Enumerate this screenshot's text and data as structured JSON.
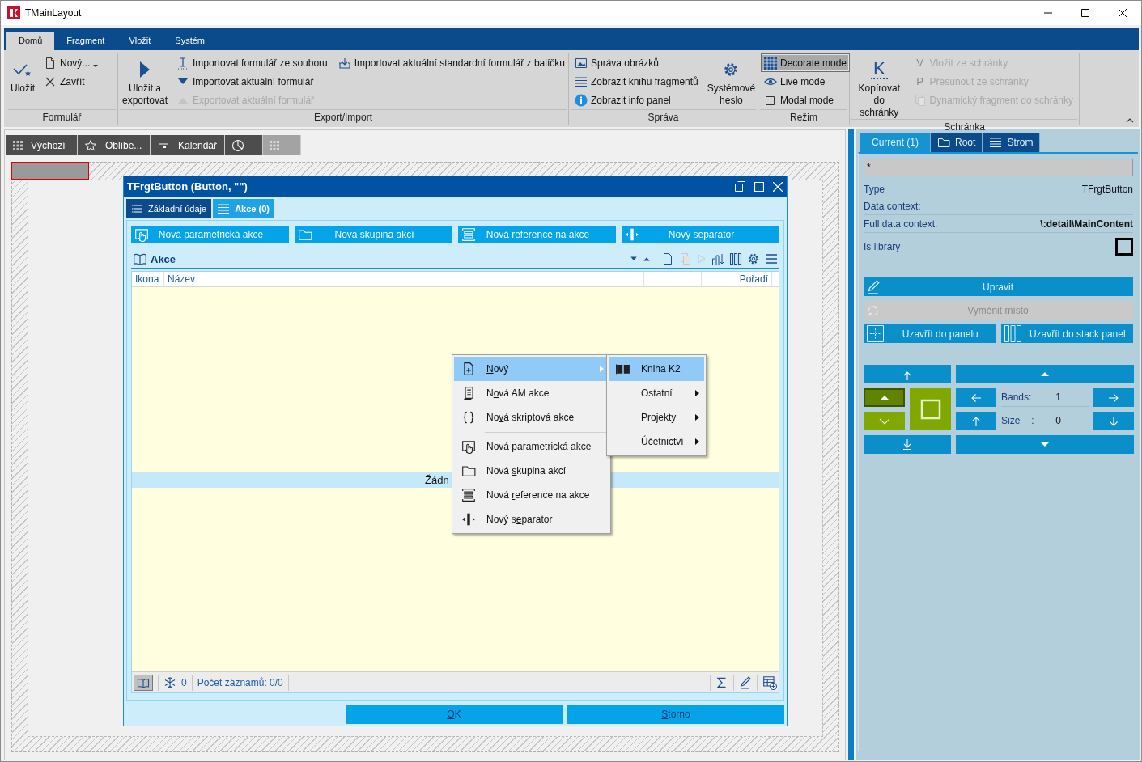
{
  "window": {
    "title": "TMainLayout"
  },
  "ribbon": {
    "tabs": [
      {
        "label": "Domů",
        "selected": true
      },
      {
        "label": "Fragment",
        "selected": false
      },
      {
        "label": "Vložit",
        "selected": false
      },
      {
        "label": "Systém",
        "selected": false
      }
    ],
    "groups": [
      {
        "label": "Formulář",
        "columns": [
          {
            "kind": "large",
            "items": [
              {
                "label": "Uložit",
                "disabled": false
              }
            ]
          },
          {
            "kind": "small",
            "items": [
              {
                "label": "Nový...",
                "disabled": false,
                "dropdown": true
              },
              {
                "label": "Zavřít",
                "disabled": false,
                "dropdown": false
              }
            ]
          }
        ]
      },
      {
        "label": "Export/Import",
        "columns": [
          {
            "kind": "large",
            "items": [
              {
                "label": "Uložit a exportovat",
                "disabled": false
              }
            ]
          },
          {
            "kind": "small",
            "items": [
              {
                "label": "Importovat formulář ze souboru",
                "disabled": false
              },
              {
                "label": "Importovat aktuální formulář",
                "disabled": false
              },
              {
                "label": "Exportovat aktuální formulář",
                "disabled": true
              }
            ]
          },
          {
            "kind": "small",
            "items": [
              {
                "label": "Importovat aktuální standardní formulář z balíčku",
                "disabled": false
              }
            ]
          }
        ]
      },
      {
        "label": "Správa",
        "columns": [
          {
            "kind": "small",
            "items": [
              {
                "label": "Správa obrázků",
                "disabled": false
              },
              {
                "label": "Zobrazit knihu fragmentů",
                "disabled": false
              },
              {
                "label": "Zobrazit info panel",
                "disabled": false
              }
            ]
          },
          {
            "kind": "large",
            "items": [
              {
                "label": "Systémové heslo",
                "disabled": false
              }
            ]
          }
        ]
      },
      {
        "label": "Režim",
        "columns": [
          {
            "kind": "small",
            "items": [
              {
                "label": "Decorate mode",
                "disabled": false,
                "selected": true
              },
              {
                "label": "Live mode",
                "disabled": false,
                "selected": false
              },
              {
                "label": "Modal mode",
                "disabled": false,
                "selected": false
              }
            ]
          }
        ]
      },
      {
        "label": "Schránka",
        "columns": [
          {
            "kind": "large",
            "items": [
              {
                "label": "Kopírovat do schránky",
                "disabled": false,
                "glyph": "K"
              }
            ]
          },
          {
            "kind": "small",
            "items": [
              {
                "label": "Vložit ze schránky",
                "disabled": true,
                "glyph": "V"
              },
              {
                "label": "Přesunout ze schránky",
                "disabled": true,
                "glyph": "P"
              },
              {
                "label": "Dynamický fragment do schránky",
                "disabled": true
              }
            ]
          }
        ]
      }
    ]
  },
  "designer": {
    "tabs": [
      {
        "label": "Výchozí",
        "selected": false
      },
      {
        "label": "Oblíbe...",
        "selected": false
      },
      {
        "label": "Kalendář",
        "selected": false
      },
      {
        "selected": false
      },
      {
        "selected": true
      }
    ]
  },
  "dialog": {
    "title": "TFrgtButton (Button, \"\")",
    "tabs": [
      {
        "label": "Základní údaje",
        "selected": false
      },
      {
        "label": "Akce (0)",
        "selected": true
      }
    ],
    "actions": [
      "Nová parametrická akce",
      "Nová skupina akcí",
      "Nová reference na akce",
      "Nový separator"
    ],
    "grid": {
      "title": "Akce",
      "columns": [
        "Ikona",
        "Název",
        "Pořadí"
      ],
      "empty_text": "Žádn",
      "count": "0",
      "status": "Počet záznamů: 0/0"
    },
    "buttons": [
      {
        "label_parts": {
          "key": "O",
          "after": "K"
        }
      },
      {
        "label_parts": {
          "key": "S",
          "after": "torno"
        }
      }
    ]
  },
  "context_menu": {
    "items": [
      {
        "kind": "item",
        "label_parts": {
          "key": "N",
          "after": "ový"
        },
        "selected": true,
        "submenu": true
      },
      {
        "kind": "item",
        "label_parts": {
          "before": "N",
          "key": "o",
          "after": "vá AM akce"
        },
        "selected": false,
        "submenu": false
      },
      {
        "kind": "item",
        "label_parts": {
          "before": "No",
          "key": "v",
          "after": "á skriptová akce"
        },
        "selected": false,
        "submenu": false
      },
      {
        "kind": "separator"
      },
      {
        "kind": "item",
        "label_parts": {
          "before": "Nová ",
          "key": "p",
          "after": "arametrická akce"
        },
        "selected": false,
        "submenu": false
      },
      {
        "kind": "item",
        "label_parts": {
          "before": "Nová ",
          "key": "s",
          "after": "kupina akcí"
        },
        "selected": false,
        "submenu": false
      },
      {
        "kind": "item",
        "label_parts": {
          "before": "Nová ",
          "key": "r",
          "after": "eference na akce"
        },
        "selected": false,
        "submenu": false
      },
      {
        "kind": "item",
        "label_parts": {
          "before": "Nový s",
          "key": "e",
          "after": "parator"
        },
        "selected": false,
        "submenu": false
      }
    ],
    "submenu": {
      "items": [
        {
          "label": "Kniha K2",
          "selected": true,
          "submenu": false
        },
        {
          "label": "Ostatní",
          "selected": false,
          "submenu": true
        },
        {
          "label": "Projekty",
          "selected": false,
          "submenu": true
        },
        {
          "label": "Účetnictví",
          "selected": false,
          "submenu": true
        }
      ]
    }
  },
  "inspector": {
    "tabs": [
      {
        "label": "Current (1)",
        "selected": true
      },
      {
        "label": "Root",
        "selected": false
      },
      {
        "label": "Strom",
        "selected": false
      }
    ],
    "filter": "*",
    "properties": [
      {
        "name": "Type",
        "value": "TFrgtButton",
        "bold": false
      },
      {
        "name": "Data context:"
      },
      {
        "name": "Full data context:",
        "value": "\\:detail\\MainContent",
        "bold": true
      }
    ],
    "is_library": {
      "label": "Is library",
      "checked": false
    },
    "buttons": [
      {
        "label": "Upravit",
        "disabled": false
      },
      {
        "label": "Vyměnit místo",
        "disabled": true
      }
    ],
    "wrap_buttons": [
      "Uzavřít do panelu",
      "Uzavřít do stack panel"
    ],
    "layout": {
      "bands_label": "Bands:",
      "bands": "1",
      "size_label": "Size",
      "size_sep": ":",
      "size": "0"
    }
  }
}
